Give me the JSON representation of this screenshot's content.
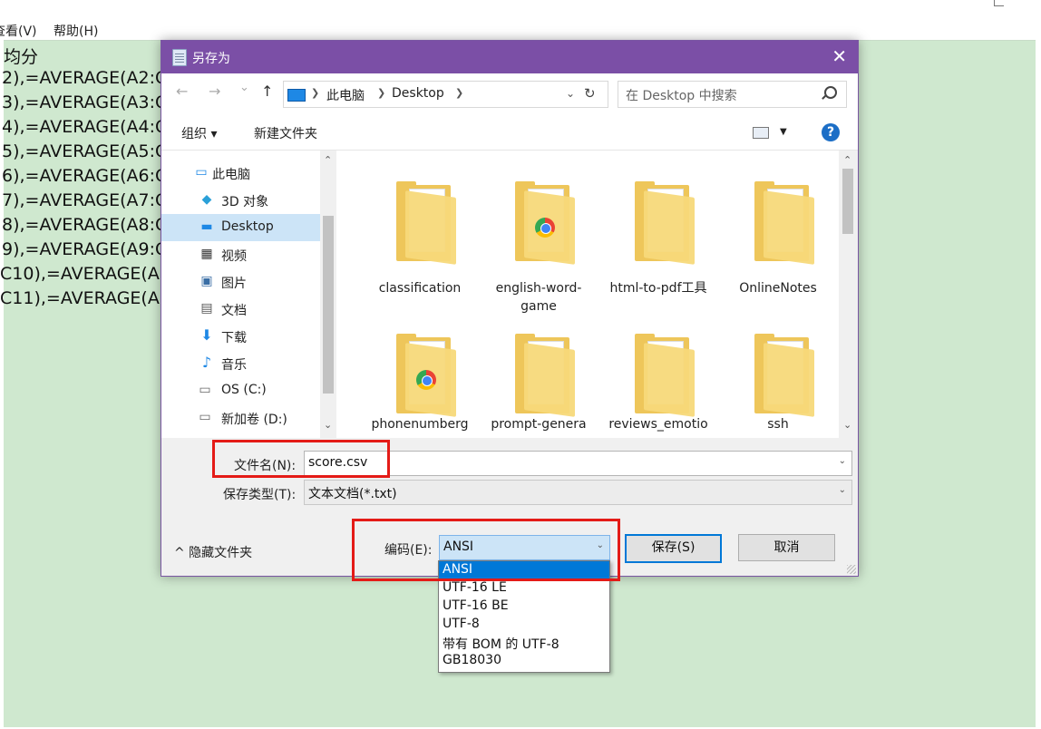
{
  "notepad": {
    "menu": [
      "查看(V)",
      "帮助(H)"
    ],
    "lines": [
      "均分",
      "2),=AVERAGE(A2:C",
      "3),=AVERAGE(A3:C",
      "4),=AVERAGE(A4:C",
      "5),=AVERAGE(A5:C",
      "6),=AVERAGE(A6:C",
      "7),=AVERAGE(A7:C",
      "8),=AVERAGE(A8:C",
      "9),=AVERAGE(A9:C",
      "C10),=AVERAGE(A",
      "C11),=AVERAGE(A"
    ],
    "colors": {
      "background": "#cfe8cf"
    }
  },
  "dialog": {
    "title": "另存为",
    "close_glyph": "✕",
    "colors": {
      "titlebar": "#7b4fa6",
      "selection": "#0078d7"
    },
    "nav": {
      "back": "←",
      "forward": "→",
      "recent": "⌄",
      "up": "↑",
      "path": [
        "此电脑",
        "Desktop"
      ],
      "refresh": "↻",
      "search_placeholder": "在 Desktop 中搜索"
    },
    "toolbar": {
      "organize": "组织 ▾",
      "new_folder": "新建文件夹",
      "help": "?"
    },
    "sidebar": [
      {
        "label": "此电脑",
        "icon": "computer-icon"
      },
      {
        "label": "3D 对象",
        "icon": "cube-3d-icon"
      },
      {
        "label": "Desktop",
        "icon": "desktop-icon",
        "selected": true
      },
      {
        "label": "视频",
        "icon": "video-icon"
      },
      {
        "label": "图片",
        "icon": "picture-icon"
      },
      {
        "label": "文档",
        "icon": "document-icon"
      },
      {
        "label": "下载",
        "icon": "download-icon"
      },
      {
        "label": "音乐",
        "icon": "music-icon"
      },
      {
        "label": "OS (C:)",
        "icon": "drive-icon"
      },
      {
        "label": "新加卷 (D:)",
        "icon": "drive-icon"
      }
    ],
    "files": [
      {
        "name": "classification",
        "icon": "folder-icon"
      },
      {
        "name": "english-word-game",
        "icon": "folder-chrome-icon"
      },
      {
        "name": "html-to-pdf工具",
        "icon": "folder-icon"
      },
      {
        "name": "OnlineNotes",
        "icon": "folder-icon"
      },
      {
        "name": "phonenumberg",
        "icon": "folder-chrome-icon"
      },
      {
        "name": "prompt-genera",
        "icon": "folder-icon"
      },
      {
        "name": "reviews_emotio",
        "icon": "folder-icon"
      },
      {
        "name": "ssh",
        "icon": "folder-icon"
      }
    ],
    "filename_label": "文件名(N):",
    "filename_value": "score.csv",
    "filetype_label": "保存类型(T):",
    "filetype_value": "文本文档(*.txt)",
    "hide_folders": "^ 隐藏文件夹",
    "encoding_label": "编码(E):",
    "encoding_value": "ANSI",
    "save_button": "保存(S)",
    "cancel_button": "取消",
    "encoding_options": [
      "ANSI",
      "UTF-16 LE",
      "UTF-16 BE",
      "UTF-8",
      "带有 BOM 的 UTF-8",
      "GB18030"
    ],
    "encoding_selected_index": 0
  }
}
